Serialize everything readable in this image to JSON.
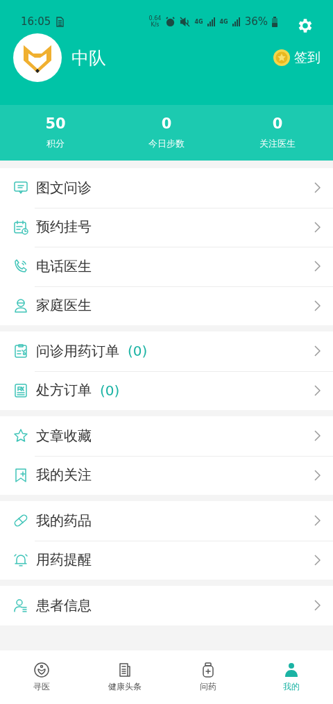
{
  "status_bar": {
    "time": "16:05",
    "net_speed": "0.64",
    "net_unit": "K/s",
    "networks": [
      "4G",
      "4G"
    ],
    "battery": "36%"
  },
  "profile": {
    "name": "中队",
    "checkin": "签到"
  },
  "stats": [
    {
      "value": "50",
      "label": "积分"
    },
    {
      "value": "0",
      "label": "今日步数"
    },
    {
      "value": "0",
      "label": "关注医生"
    }
  ],
  "menu_groups": [
    [
      {
        "kind": "chat",
        "label": "图文问诊"
      },
      {
        "kind": "calendar",
        "label": "预约挂号"
      },
      {
        "kind": "phone",
        "label": "电话医生"
      },
      {
        "kind": "doctor",
        "label": "家庭医生"
      }
    ],
    [
      {
        "kind": "clipboard",
        "label": "问诊用药订单",
        "count": "(0)"
      },
      {
        "kind": "rx",
        "label": "处方订单",
        "count": "(0)"
      }
    ],
    [
      {
        "kind": "star",
        "label": "文章收藏"
      },
      {
        "kind": "bookmark",
        "label": "我的关注"
      }
    ],
    [
      {
        "kind": "pill",
        "label": "我的药品"
      },
      {
        "kind": "bell",
        "label": "用药提醒"
      }
    ],
    [
      {
        "kind": "person",
        "label": "患者信息"
      }
    ]
  ],
  "tabs": [
    {
      "kind": "heart",
      "label": "寻医",
      "selected": false
    },
    {
      "kind": "news",
      "label": "健康头条",
      "selected": false
    },
    {
      "kind": "bottle",
      "label": "问药",
      "selected": false
    },
    {
      "kind": "user",
      "label": "我的",
      "selected": true
    }
  ]
}
